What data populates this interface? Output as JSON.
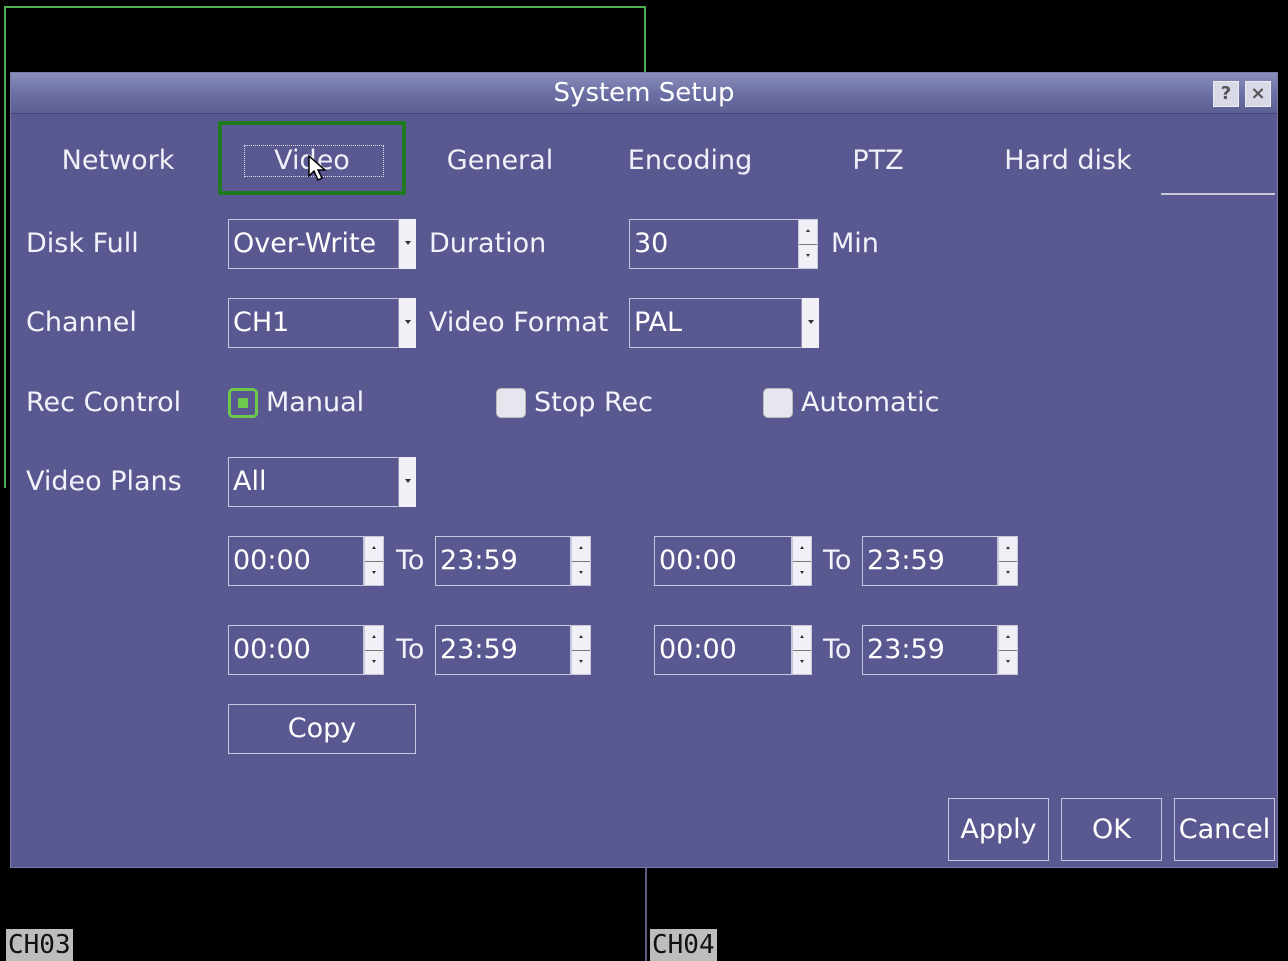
{
  "dialog": {
    "title": "System Setup",
    "help_label": "?",
    "close_label": "×"
  },
  "tabs": [
    {
      "label": "Network",
      "active": false
    },
    {
      "label": "Video",
      "active": true
    },
    {
      "label": "General",
      "active": false
    },
    {
      "label": "Encoding",
      "active": false
    },
    {
      "label": "PTZ",
      "active": false
    },
    {
      "label": "Hard disk",
      "active": false
    }
  ],
  "form": {
    "disk_full_label": "Disk Full",
    "disk_full_value": "Over-Write",
    "duration_label": "Duration",
    "duration_value": "30",
    "duration_unit": "Min",
    "channel_label": "Channel",
    "channel_value": "CH1",
    "video_format_label": "Video Format",
    "video_format_value": "PAL",
    "rec_control_label": "Rec Control",
    "rec_options": [
      {
        "label": "Manual",
        "selected": true
      },
      {
        "label": "Stop Rec",
        "selected": false
      },
      {
        "label": "Automatic",
        "selected": false
      }
    ],
    "video_plans_label": "Video Plans",
    "video_plans_value": "All",
    "to_label": "To",
    "schedules": [
      {
        "from": "00:00",
        "to": "23:59"
      },
      {
        "from": "00:00",
        "to": "23:59"
      },
      {
        "from": "00:00",
        "to": "23:59"
      },
      {
        "from": "00:00",
        "to": "23:59"
      }
    ],
    "copy_label": "Copy"
  },
  "buttons": {
    "apply": "Apply",
    "ok": "OK",
    "cancel": "Cancel"
  },
  "channels": {
    "ch3": "CH03",
    "ch4": "CH04"
  },
  "colors": {
    "panel": "#5a5890",
    "selection_green": "#4caf50",
    "radio_green": "#6ec84a"
  }
}
